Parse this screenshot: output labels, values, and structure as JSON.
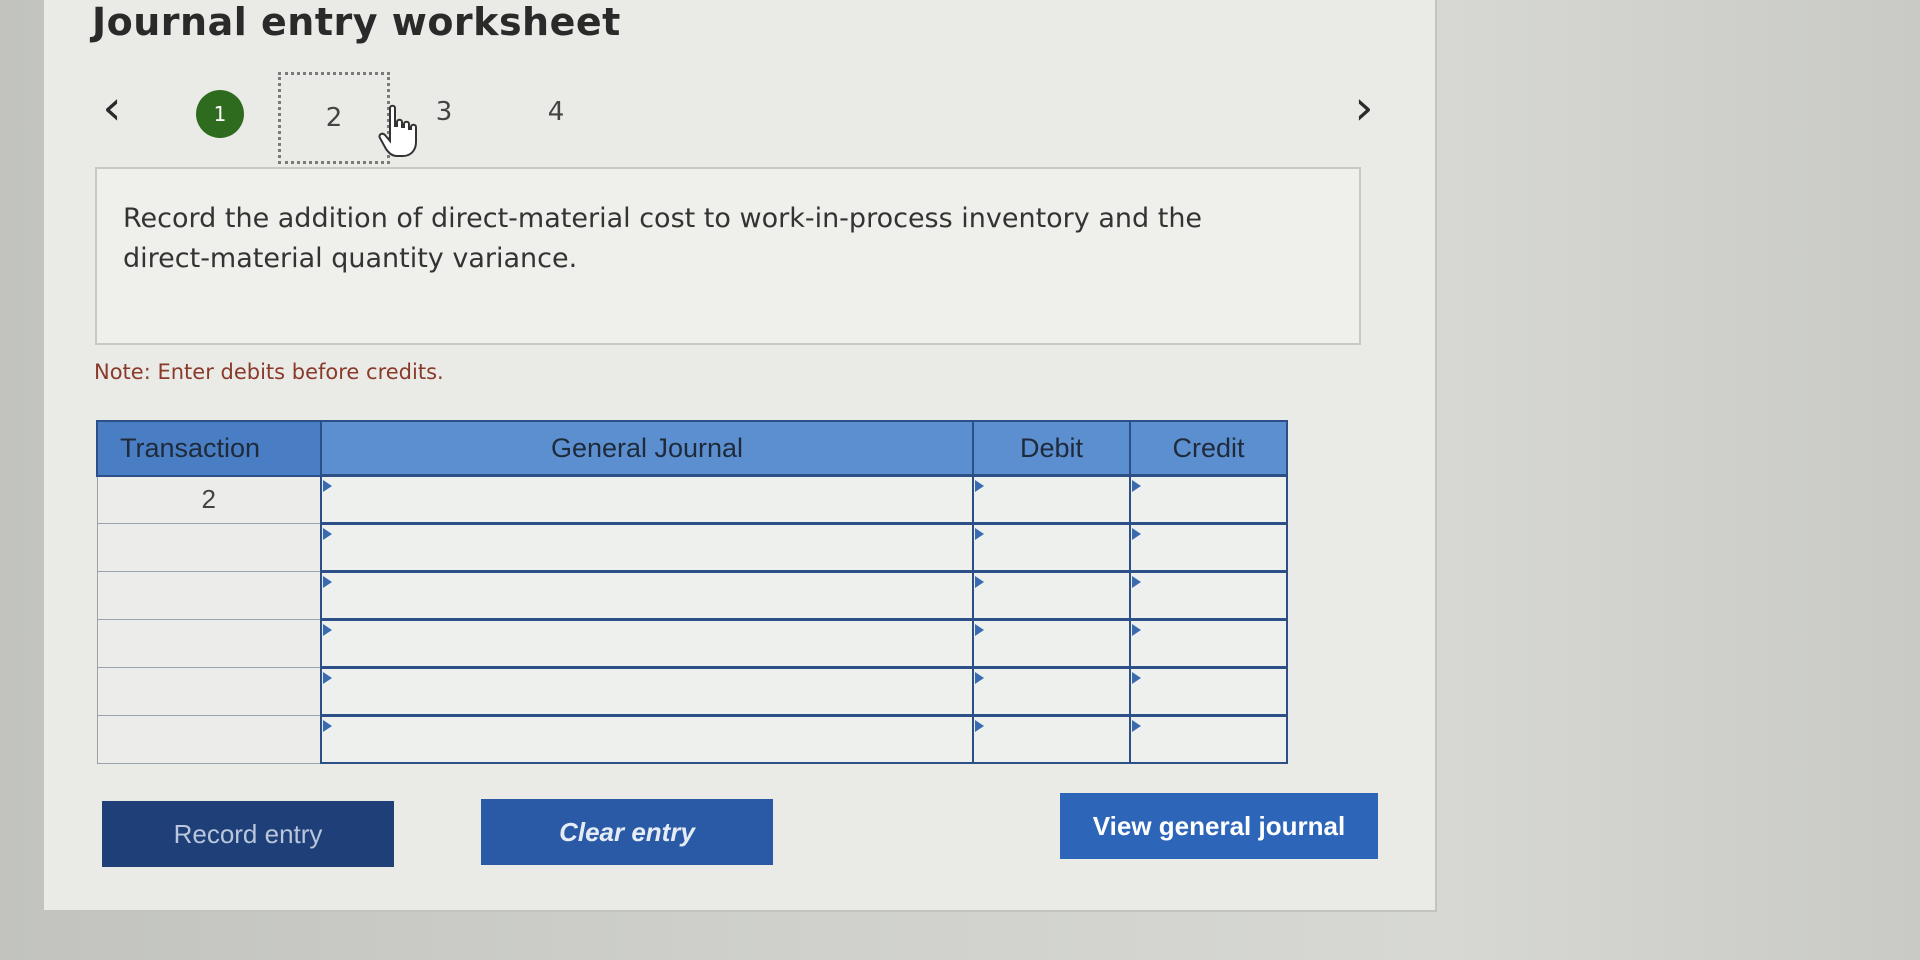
{
  "page": {
    "title": "Journal entry worksheet"
  },
  "stepper": {
    "prev_glyph": "‹",
    "next_glyph": "›",
    "steps": [
      "1",
      "2",
      "3",
      "4"
    ],
    "current": "2"
  },
  "prompt": {
    "text": "Record the addition of direct-material cost to work-in-process inventory and the direct-material quantity variance."
  },
  "note": {
    "text": "Note: Enter debits before credits."
  },
  "table": {
    "headers": [
      "Transaction",
      "General Journal",
      "Debit",
      "Credit"
    ],
    "rows": [
      {
        "transaction": "2",
        "account": "",
        "debit": "",
        "credit": ""
      },
      {
        "transaction": "",
        "account": "",
        "debit": "",
        "credit": ""
      },
      {
        "transaction": "",
        "account": "",
        "debit": "",
        "credit": ""
      },
      {
        "transaction": "",
        "account": "",
        "debit": "",
        "credit": ""
      },
      {
        "transaction": "",
        "account": "",
        "debit": "",
        "credit": ""
      },
      {
        "transaction": "",
        "account": "",
        "debit": "",
        "credit": ""
      }
    ]
  },
  "buttons": {
    "record": "Record entry",
    "clear": "Clear entry",
    "view": "View general journal"
  },
  "colors": {
    "step_done": "#2f6b1f",
    "header_bg": "#5b8fd0",
    "grid_border": "#2b4f86",
    "note_text": "#8a3a2a"
  },
  "icons": {
    "pointer": "hand-pointer-icon",
    "prev": "chevron-left-icon",
    "next": "chevron-right-icon"
  }
}
